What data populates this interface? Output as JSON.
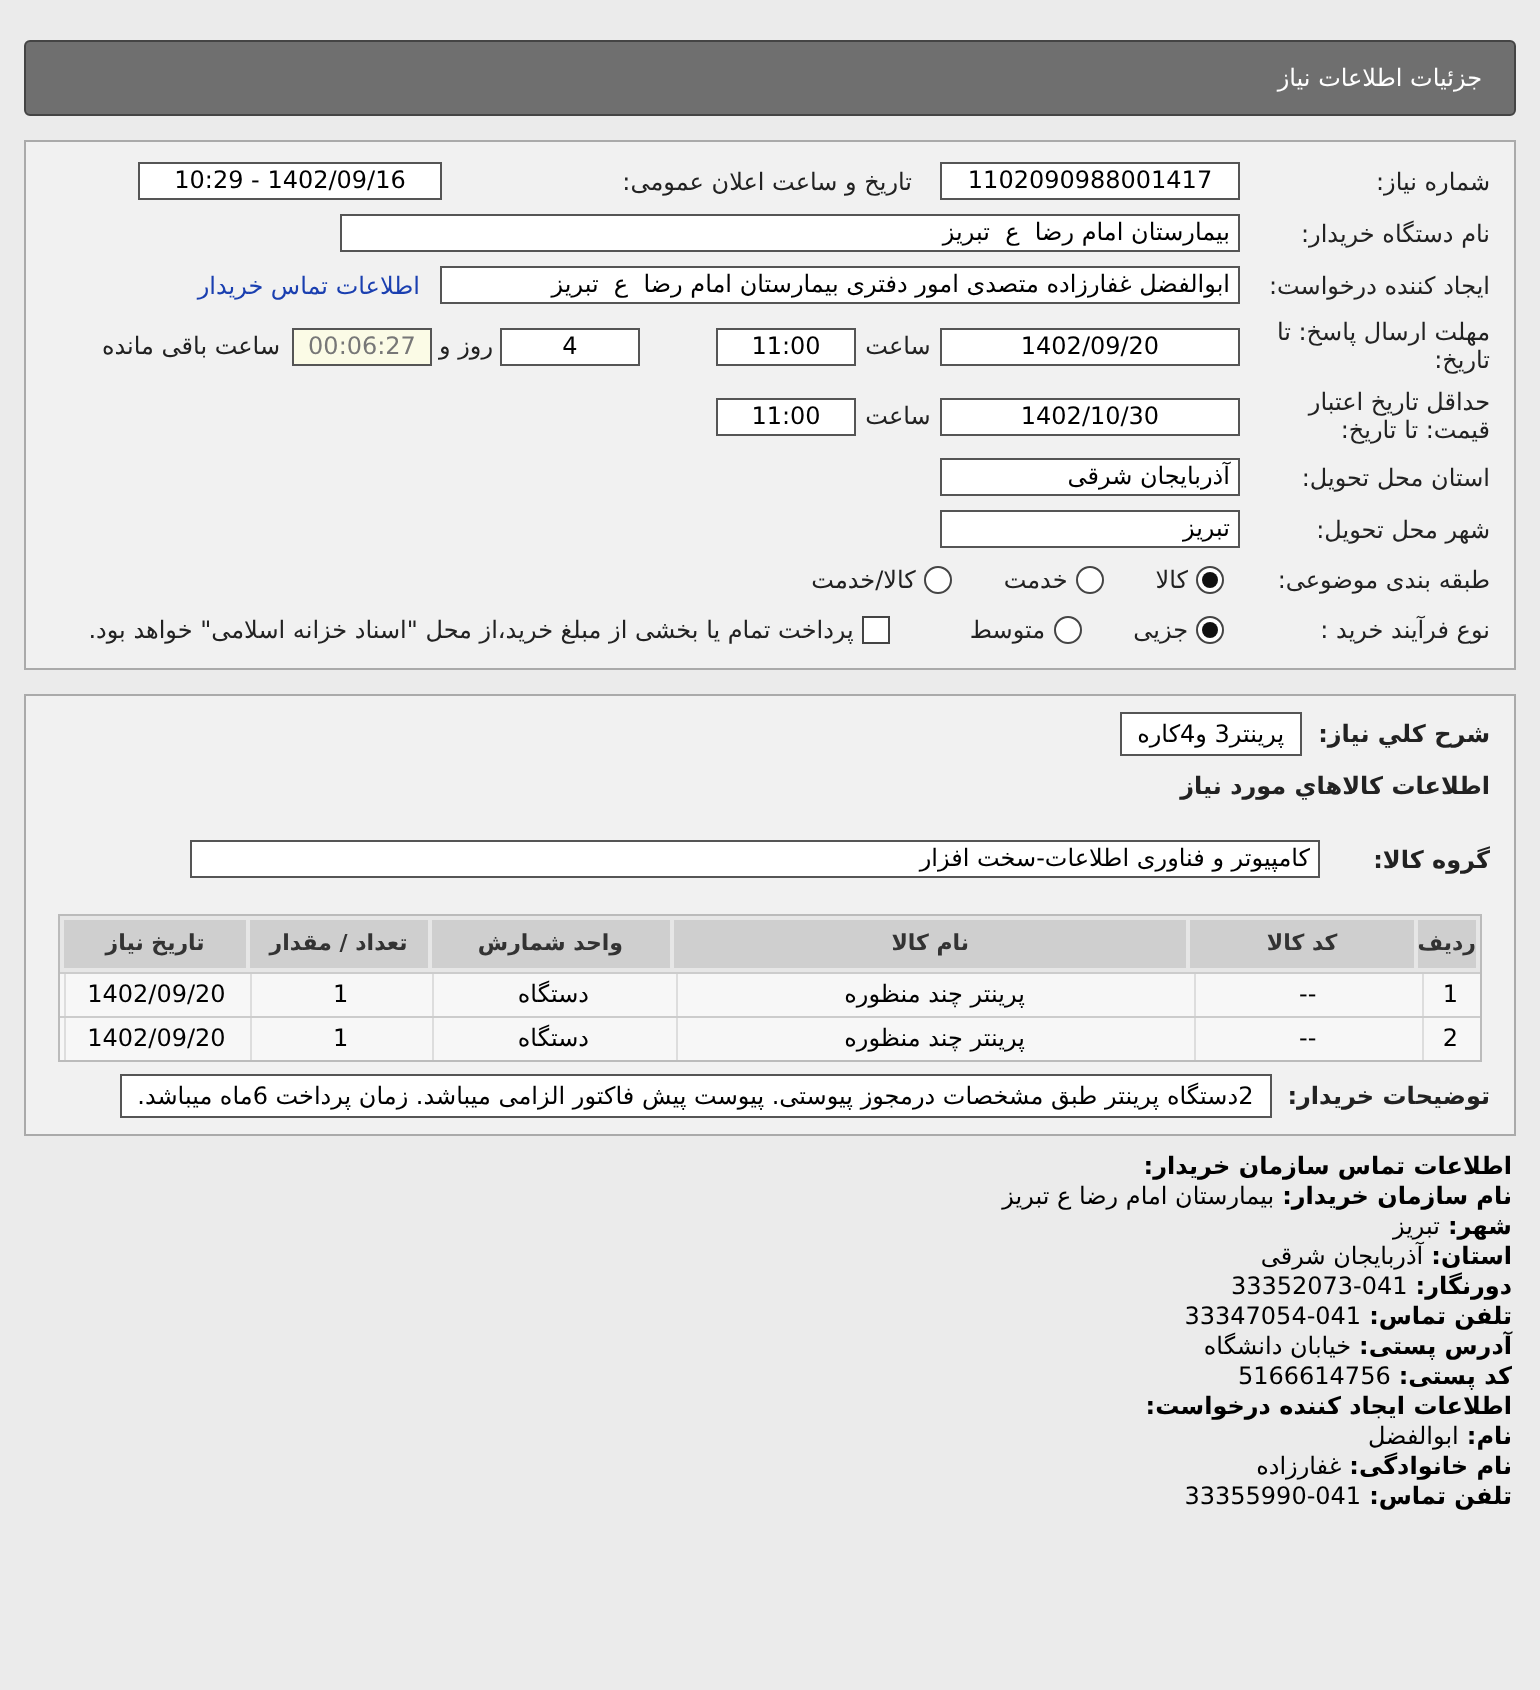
{
  "header": {
    "title": "جزئيات اطلاعات نياز"
  },
  "details": {
    "need_number": {
      "label": "شماره نیاز:",
      "value": "1102090988001417"
    },
    "announce": {
      "label": "تاریخ و ساعت اعلان عمومی:",
      "value": "1402/09/16 - 10:29"
    },
    "buyer": {
      "label": "نام دستگاه خریدار:",
      "value": "بیمارستان امام رضا  ع  تبریز"
    },
    "creator": {
      "label": "ایجاد کننده درخواست:",
      "value": "ابوالفضل غفارزاده متصدی امور دفتری بیمارستان امام رضا  ع  تبریز",
      "link": "اطلاعات تماس خریدار"
    },
    "deadline": {
      "label": "مهلت ارسال پاسخ: تا تاریخ:",
      "date": "1402/09/20",
      "time_label": "ساعت",
      "time": "11:00",
      "days": "4",
      "days_label": "روز و",
      "remaining": "00:06:27",
      "remaining_label": "ساعت باقی مانده"
    },
    "validity": {
      "label": "حداقل تاریخ اعتبار قیمت: تا تاریخ:",
      "date": "1402/10/30",
      "time_label": "ساعت",
      "time": "11:00"
    },
    "province": {
      "label": "استان محل تحویل:",
      "value": "آذربایجان شرقی"
    },
    "city": {
      "label": "شهر محل تحویل:",
      "value": "تبریز"
    },
    "category": {
      "label": "طبقه بندی موضوعی:",
      "options": [
        {
          "label": "کالا",
          "selected": true
        },
        {
          "label": "خدمت",
          "selected": false
        },
        {
          "label": "کالا/خدمت",
          "selected": false
        }
      ]
    },
    "process": {
      "label": "نوع فرآیند خرید :",
      "options": [
        {
          "label": "جزیی",
          "selected": true
        },
        {
          "label": "متوسط",
          "selected": false
        }
      ],
      "payment": {
        "checked": false,
        "text": "پرداخت تمام یا بخشی از مبلغ خرید،از محل \"اسناد خزانه اسلامی\" خواهد بود."
      }
    }
  },
  "goods": {
    "description": {
      "label": "شرح کلي نياز:",
      "value": "پرینتر3 و4کاره"
    },
    "section_title": "اطلاعات کالاهاي مورد نياز",
    "group": {
      "label": "گروه کالا:",
      "value": "کامپیوتر و فناوری اطلاعات-سخت افزار"
    },
    "table": {
      "columns": [
        "ردیف",
        "کد کالا",
        "نام کالا",
        "واحد شمارش",
        "تعداد / مقدار",
        "تاریخ نیاز"
      ],
      "rows": [
        [
          "1",
          "--",
          "پرینتر چند منظوره",
          "دستگاه",
          "1",
          "1402/09/20"
        ],
        [
          "2",
          "--",
          "پرینتر چند منظوره",
          "دستگاه",
          "1",
          "1402/09/20"
        ]
      ]
    },
    "notes": {
      "label": "توضیحات خریدار:",
      "value": "2دستگاه پرینتر طبق مشخصات درمجوز پیوستی. پیوست پیش فاکتور الزامی میباشد. زمان پرداخت 6ماه میباشد."
    }
  },
  "contact": {
    "lines": [
      {
        "kind": "heading",
        "label": "اطلاعات تماس سازمان خریدار:"
      },
      {
        "kind": "field",
        "label": "نام سازمان خریدار:",
        "value": "بیمارستان امام رضا ع تبریز"
      },
      {
        "kind": "field",
        "label": "شهر:",
        "value": "تبریز"
      },
      {
        "kind": "field",
        "label": "استان:",
        "value": "آذربایجان شرقی"
      },
      {
        "kind": "field",
        "label": "دورنگار:",
        "value": "33352073-041"
      },
      {
        "kind": "field",
        "label": "تلفن تماس:",
        "value": "33347054-041"
      },
      {
        "kind": "field",
        "label": "آدرس پستی:",
        "value": "خیابان دانشگاه"
      },
      {
        "kind": "field",
        "label": "کد پستی:",
        "value": "5166614756"
      },
      {
        "kind": "heading",
        "label": "اطلاعات ایجاد کننده درخواست:"
      },
      {
        "kind": "field",
        "label": "نام:",
        "value": "ابوالفضل"
      },
      {
        "kind": "field",
        "label": "نام خانوادگی:",
        "value": "غفارزاده"
      },
      {
        "kind": "field",
        "label": "تلفن تماس:",
        "value": "33355990-041"
      }
    ]
  }
}
